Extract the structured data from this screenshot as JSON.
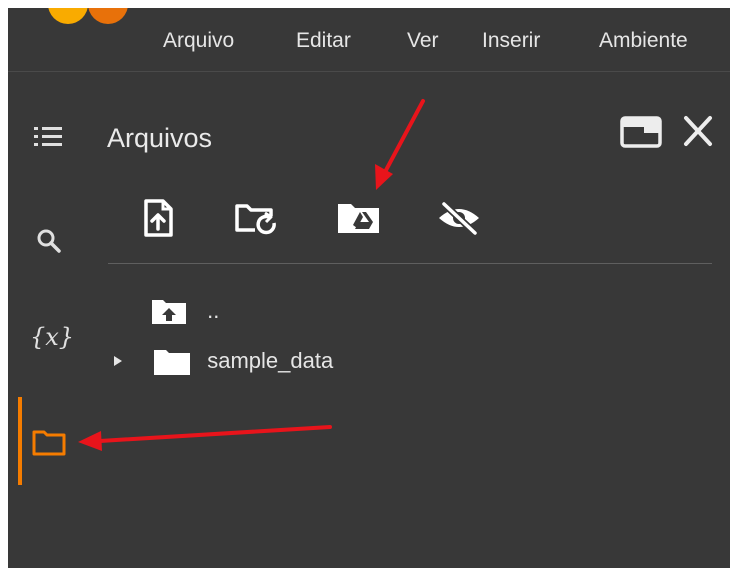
{
  "menu": {
    "items": [
      "Arquivo",
      "Editar",
      "Ver",
      "Inserir",
      "Ambiente"
    ]
  },
  "sidebar": {
    "rail": [
      {
        "name": "table-of-contents-icon"
      },
      {
        "name": "search-icon"
      },
      {
        "name": "variables-icon",
        "label": "{x}"
      },
      {
        "name": "folder-icon",
        "active": true
      }
    ]
  },
  "panel": {
    "title": "Arquivos",
    "controls": [
      "open-in-tab-icon",
      "close-icon"
    ],
    "toolbar": [
      "upload-file-icon",
      "refresh-folder-icon",
      "mount-drive-icon",
      "hidden-files-icon"
    ]
  },
  "tree": {
    "parent_label": "..",
    "items": [
      {
        "label": "sample_data",
        "type": "folder",
        "expanded": false
      }
    ]
  },
  "colors": {
    "background": "#383838",
    "text": "#e6e6e6",
    "accent": "#f57c00",
    "annotation_arrow": "#e8141b"
  }
}
